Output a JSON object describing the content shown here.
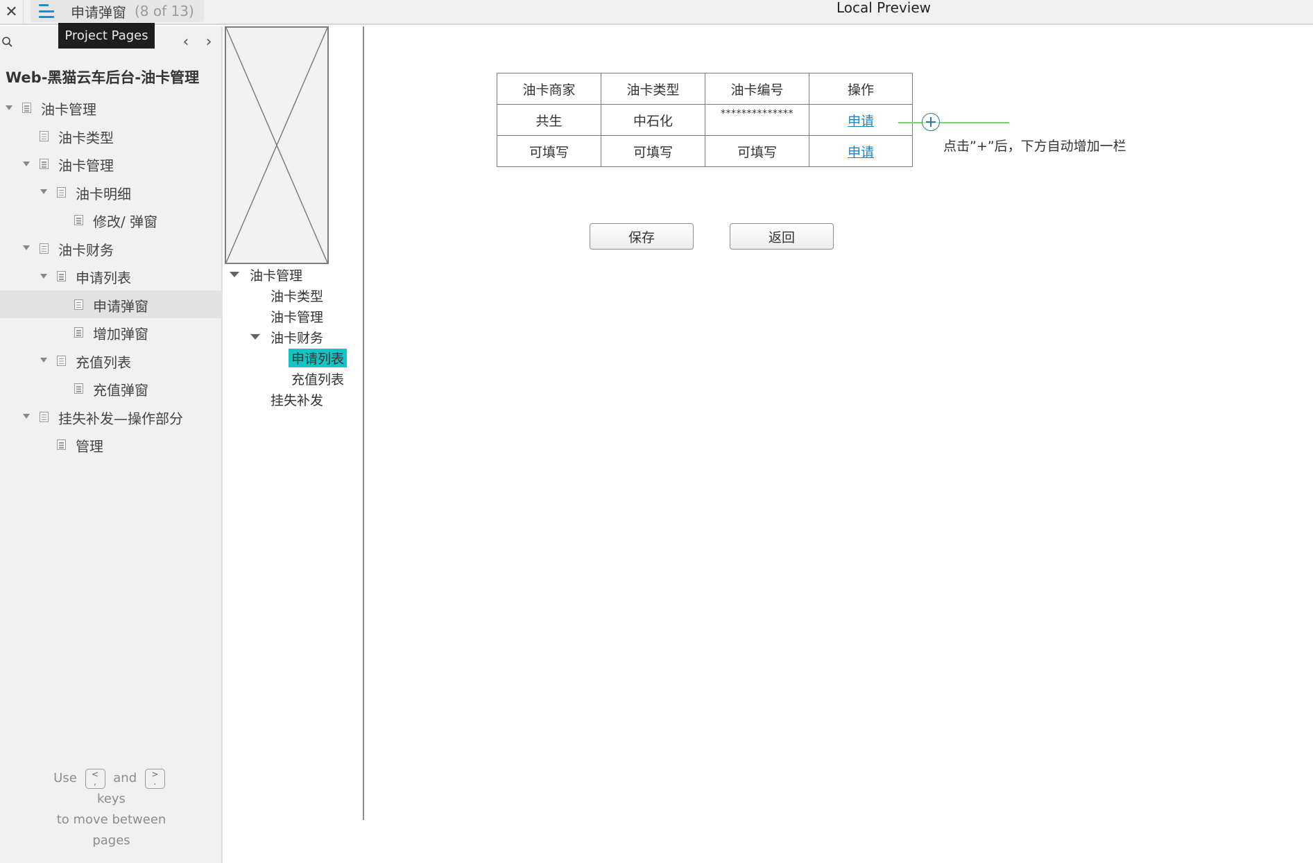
{
  "topbar": {
    "close_label": "✕",
    "page_title": "申请弹窗",
    "page_count": "(8 of 13)",
    "window_title": "Local Preview",
    "tooltip": "Project Pages"
  },
  "sidebar": {
    "project_title": "Web-黑猫云车后台-油卡管理",
    "nav_prev": "‹",
    "nav_next": "›",
    "tree": [
      {
        "label": "油卡管理",
        "level": 0,
        "expanded": true
      },
      {
        "label": "油卡类型",
        "level": 1,
        "expanded": null
      },
      {
        "label": "油卡管理",
        "level": 1,
        "expanded": true
      },
      {
        "label": "油卡明细",
        "level": 2,
        "expanded": true
      },
      {
        "label": "修改/ 弹窗",
        "level": 3,
        "expanded": null
      },
      {
        "label": "油卡财务",
        "level": 1,
        "expanded": true
      },
      {
        "label": "申请列表",
        "level": 2,
        "expanded": true
      },
      {
        "label": "申请弹窗",
        "level": 3,
        "expanded": null,
        "selected": true
      },
      {
        "label": "增加弹窗",
        "level": 3,
        "expanded": null
      },
      {
        "label": "充值列表",
        "level": 2,
        "expanded": true
      },
      {
        "label": "充值弹窗",
        "level": 3,
        "expanded": null
      },
      {
        "label": "挂失补发—操作部分",
        "level": 1,
        "expanded": true
      },
      {
        "label": "管理",
        "level": 2,
        "expanded": null
      }
    ],
    "help": {
      "use": "Use",
      "key_prev_top": "<",
      "key_prev_bottom": ",",
      "and": "and",
      "key_next_top": ">",
      "key_next_bottom": ".",
      "keys": "keys",
      "line2": "to move between",
      "line3": "pages"
    }
  },
  "mid_nav": {
    "items": [
      {
        "label": "油卡管理",
        "expanded": true
      },
      {
        "label": "油卡类型"
      },
      {
        "label": "油卡管理"
      },
      {
        "label": "油卡财务",
        "expanded": true
      },
      {
        "label": "申请列表",
        "selected": true
      },
      {
        "label": "充值列表"
      },
      {
        "label": "挂失补发"
      }
    ],
    "highlight_color": "#14c4c4"
  },
  "main": {
    "table": {
      "headers": [
        "油卡商家",
        "油卡类型",
        "油卡编号",
        "操作"
      ],
      "rows": [
        [
          "共生",
          "中石化",
          "**************",
          "申请"
        ],
        [
          "可填写",
          "可填写",
          "可填写",
          "申请"
        ]
      ]
    },
    "annotation": "点击”+”后，下方自动增加一栏",
    "save_label": "保存",
    "back_label": "返回",
    "link_color": "#1b84c6",
    "connector_color": "#7ad36a"
  }
}
